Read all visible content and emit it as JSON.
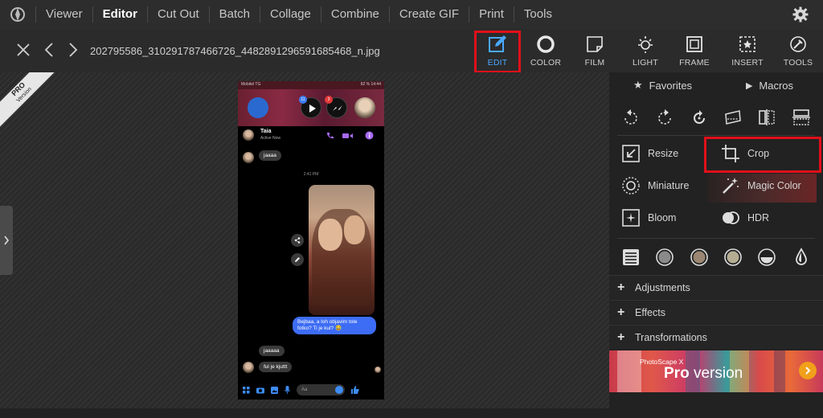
{
  "menu": {
    "items": [
      "Viewer",
      "Editor",
      "Cut Out",
      "Batch",
      "Collage",
      "Combine",
      "Create GIF",
      "Print",
      "Tools"
    ],
    "active": "Editor"
  },
  "toolbar": {
    "filename": "202795586_310291787466726_4482891296591685468_n.jpg",
    "tools": [
      {
        "label": "EDIT",
        "icon": "edit-icon",
        "active": true
      },
      {
        "label": "COLOR",
        "icon": "color-icon",
        "active": false
      },
      {
        "label": "FILM",
        "icon": "film-icon",
        "active": false
      },
      {
        "label": "LIGHT",
        "icon": "light-icon",
        "active": false
      },
      {
        "label": "FRAME",
        "icon": "frame-icon",
        "active": false
      },
      {
        "label": "INSERT",
        "icon": "insert-icon",
        "active": false
      },
      {
        "label": "TOOLS",
        "icon": "tools-icon",
        "active": false
      }
    ],
    "accent": "#4aa8ff",
    "highlight_color": "#e0101a"
  },
  "canvas": {
    "pro_badge": {
      "line1": "PRO",
      "line2": "Version"
    }
  },
  "phone": {
    "status_left": "Mobitel TG",
    "status_right": "82 % 14:44",
    "badges": [
      "11",
      "3"
    ],
    "contact_name": "Taia",
    "contact_status": "Active Now",
    "messages": {
      "m1": "jaaaa",
      "time": "2:41 PM",
      "m2": "Bejbaa, a loh objavim tole fotko? Ti je kul? 😂",
      "m3": "jaaaaa",
      "m4": "ful je kjuttt"
    },
    "input_placeholder": "Aa"
  },
  "panel": {
    "tabs": [
      {
        "label": "Favorites",
        "icon": "star-icon"
      },
      {
        "label": "Macros",
        "icon": "play-icon"
      }
    ],
    "features": [
      {
        "label": "Resize",
        "icon": "resize-icon"
      },
      {
        "label": "Crop",
        "icon": "crop-icon"
      },
      {
        "label": "Miniature",
        "icon": "miniature-icon"
      },
      {
        "label": "Magic Color",
        "icon": "magic-wand-icon"
      },
      {
        "label": "Bloom",
        "icon": "bloom-icon"
      },
      {
        "label": "HDR",
        "icon": "hdr-icon"
      }
    ],
    "sections": [
      "Adjustments",
      "Effects",
      "Transformations"
    ],
    "promo": {
      "small": "PhotoScape X",
      "big_bold": "Pro",
      "big_rest": " version"
    }
  }
}
